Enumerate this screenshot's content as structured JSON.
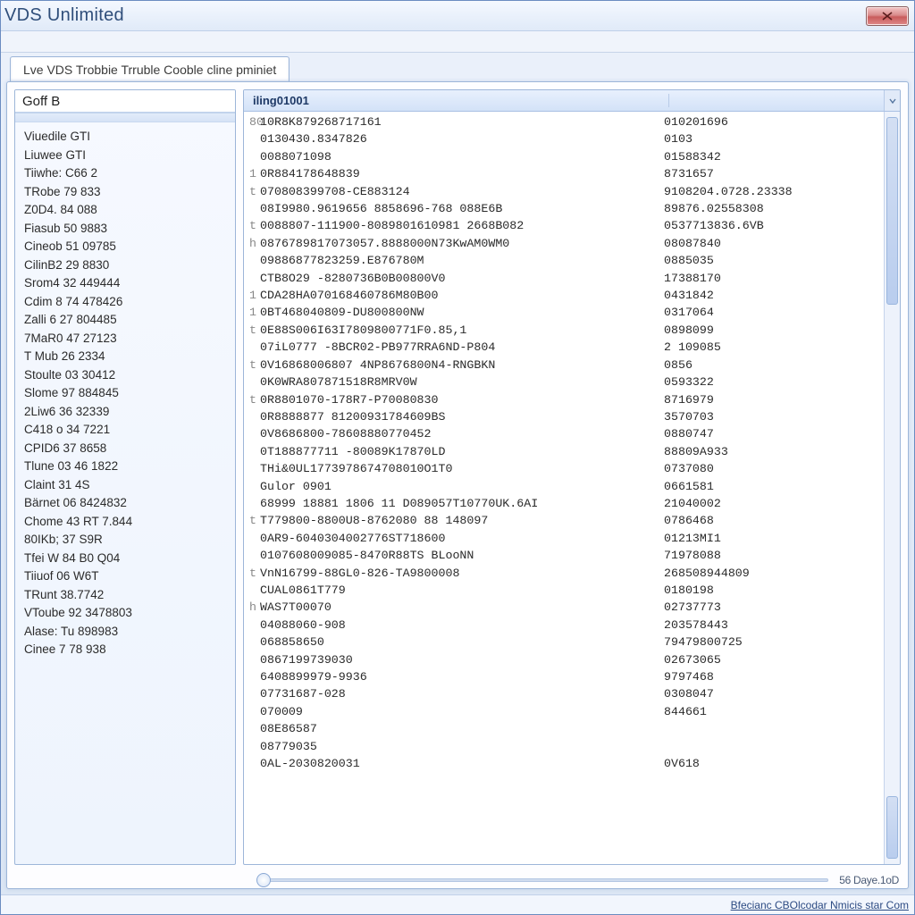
{
  "window": {
    "title": "VDS Unlimited",
    "close_label": "Close"
  },
  "tabs": [
    {
      "label": "Lve VDS Trobbie Trruble Cooble cline pminiet"
    }
  ],
  "sidebar": {
    "header": "Goff B",
    "items": [
      "Viuedile GTI",
      "Liuwee GTI",
      "Tiiwhe: C66 2",
      "TRobe 79 833",
      "Z0D4. 84 088",
      "Fiasub 50 9883",
      "Cineob 51 09785",
      "CilinB2 29 8830",
      "Srom4 32 449444",
      "Cdim 8 74 478426",
      "Zalli 6 27 804485",
      "7MaR0 47 27123",
      "T Mub 26 2334",
      "Stoulte 03 30412",
      "Slome 97 884845",
      "2Liw6 36 32339",
      "C418 o 34 7221",
      "CPID6 37 8658",
      "Tlune 03 46 1822",
      "Claint  31 4S",
      "Bärnet 06 8424832",
      "Chome 43 RT  7.844",
      "80IKb; 37 S9R",
      "Tfei W  84 B0 Q04",
      "Tiiuof  06 W6T",
      "TRunt 38.7742",
      "VToube 92 3478803",
      "Alase: Tu 898983",
      "Cinee 7 78 938"
    ]
  },
  "dataview": {
    "header_a": "iling01001",
    "header_b": "",
    "rows": [
      {
        "m": "80",
        "a": "10R8K879268717161",
        "b": "010201696"
      },
      {
        "m": "",
        "a": "0130430.8347826",
        "b": "0103"
      },
      {
        "m": "",
        "a": "0088071098",
        "b": "01588342"
      },
      {
        "m": "1",
        "a": "0R884178648839",
        "b": "8731657"
      },
      {
        "m": "t",
        "a": "070808399708-CE883124",
        "b": "9108204.0728.23338"
      },
      {
        "m": "",
        "a": "08I9980.9619656 8858696-768       088E6B",
        "b": "89876.02558308"
      },
      {
        "m": "t",
        "a": "0088807-111900-8089801610981 2668B082",
        "b": "0537713836.6VB"
      },
      {
        "m": "h",
        "a": "0876789817073057.8888000N73KwAM0WM0",
        "b": "08087840"
      },
      {
        "m": "",
        "a": "09886877823259.E876780M",
        "b": "0885035"
      },
      {
        "m": "",
        "a": "CTB8O29 -8280736B0B00800V0",
        "b": "17388170"
      },
      {
        "m": "1",
        "a": "CDA28HA070168460786M80B00",
        "b": "0431842"
      },
      {
        "m": "1",
        "a": "0BT468040809-DU800800NW",
        "b": "0317064"
      },
      {
        "m": "t",
        "a": "0E88S006I63I7809800771F0.85,1",
        "b": "0898099"
      },
      {
        "m": "",
        "a": "07iL0777 -8BCR02-PB977RRA6ND-P804",
        "b": "2  109085"
      },
      {
        "m": "t",
        "a": "0V16868006807  4NP8676800N4-RNGBKN",
        "b": "0856"
      },
      {
        "m": "",
        "a": "0K0WRA807871518R8MRV0W",
        "b": "0593322"
      },
      {
        "m": "t",
        "a": "0R8801070-178R7-P70080830",
        "b": "8716979"
      },
      {
        "m": "",
        "a": "0R8888877 81200931784609BS",
        "b": "3570703"
      },
      {
        "m": "",
        "a": "0V8686800-78608880770452",
        "b": "0880747",
        "b2": ""
      },
      {
        "m": "",
        "a": "0T188877711 -80089K17870LD",
        "b": "88809A933"
      },
      {
        "m": "",
        "a": "THi&0UL1773978674708010O1T0",
        "b": "0737080"
      },
      {
        "m": "",
        "a": "Gulor 0901",
        "b": "0661581"
      },
      {
        "m": "",
        "a": "68999 18881   1806 11 D089057T10770UK.6AI",
        "b": "21040002"
      },
      {
        "m": "t",
        "a": "T779800-8800U8-8762080 88 148097",
        "b": "0786468"
      },
      {
        "m": "",
        "a": "0AR9-6040304002776ST718600",
        "b": "01213MI1"
      },
      {
        "m": "",
        "a": "0107608009085-8470R88TS BLooNN",
        "b": "71978088"
      },
      {
        "m": "t",
        "a": "VnN16799-88GL0-826-TA9800008",
        "b": "268508944809"
      },
      {
        "m": "",
        "a": "CUAL0861T779",
        "b": "0180198"
      },
      {
        "m": "h",
        "a": "WAS7T00070",
        "b": "02737773"
      },
      {
        "m": "",
        "a": "04088060-908",
        "b": "203578443"
      },
      {
        "m": "",
        "a": "068858650",
        "b": "79479800725"
      },
      {
        "m": "",
        "a": "0867199739030",
        "b": "02673065"
      },
      {
        "m": "",
        "a": "6408899979-9936",
        "b": "9797468"
      },
      {
        "m": "",
        "a": "07731687-028",
        "b": "0308047",
        "b2": ""
      },
      {
        "m": "",
        "a": "070009",
        "b": "844661",
        "b2": ""
      },
      {
        "m": "",
        "a": "08E86587",
        "b": ""
      },
      {
        "m": "",
        "a": "08779035",
        "b": ""
      },
      {
        "m": "",
        "a": "0AL-2030820031",
        "b": "0V618"
      }
    ]
  },
  "slider": {
    "label": "56 Daye.1oD"
  },
  "status": {
    "text": "Bfecianc CBOlcodar Nmicis star Com"
  }
}
